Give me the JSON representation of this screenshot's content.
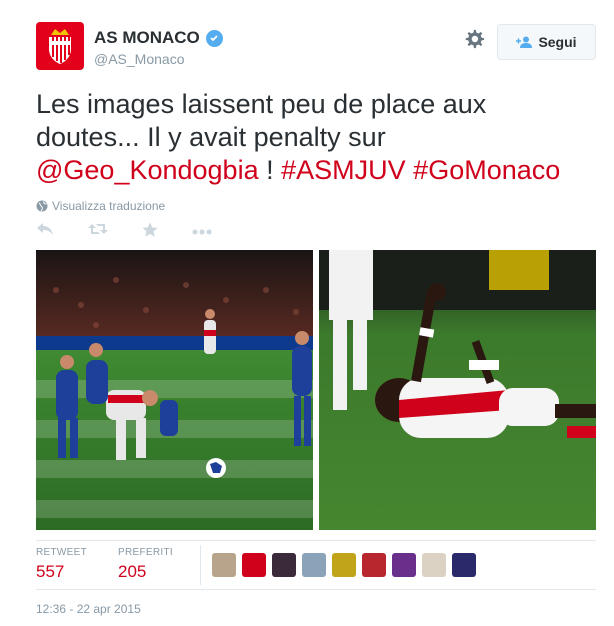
{
  "account": {
    "name": "AS MONACO",
    "handle": "@AS_Monaco",
    "follow_label": "Segui"
  },
  "tweet": {
    "line1": "Les images laissent peu de place aux",
    "line2": "doutes... Il y avait penalty sur",
    "mention": "@Geo_Kondogbia",
    "exclaim": " ! ",
    "hashtag1": "#ASMJUV",
    "hashtag2": "#GoMonaco"
  },
  "translate_label": "Visualizza traduzione",
  "stats": {
    "retweet_label": "RETWEET",
    "retweet_count": "557",
    "fav_label": "PREFERITI",
    "fav_count": "205"
  },
  "timestamp": "12:36 - 22 apr 2015",
  "colors": {
    "link": "#d0021b",
    "brand": "#e2001a",
    "muted": "#8899a6"
  },
  "icons": [
    "verified-icon",
    "gear-icon",
    "follow-person-icon",
    "globe-icon",
    "reply-icon",
    "retweet-icon",
    "favorite-icon",
    "more-icon"
  ]
}
